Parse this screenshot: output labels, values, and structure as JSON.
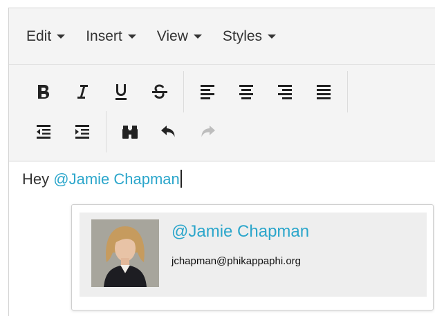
{
  "menu": {
    "items": [
      {
        "label": "Edit"
      },
      {
        "label": "Insert"
      },
      {
        "label": "View"
      },
      {
        "label": "Styles"
      }
    ]
  },
  "toolbar": {
    "row1": [
      "bold-icon",
      "italic-icon",
      "underline-icon",
      "strikethrough-icon",
      "align-left-icon",
      "align-center-icon",
      "align-right-icon",
      "align-justify-icon"
    ],
    "row2": [
      "outdent-icon",
      "indent-icon",
      "find-icon",
      "undo-icon",
      "redo-icon"
    ]
  },
  "content": {
    "text": "Hey ",
    "mention": "@Jamie Chapman"
  },
  "suggestion": {
    "name": "@Jamie Chapman",
    "email": "jchapman@phikappaphi.org"
  },
  "colors": {
    "mention": "#2ba6cb",
    "toolbar_bg": "#f4f4f4",
    "suggestion_bg": "#eeeeee"
  }
}
